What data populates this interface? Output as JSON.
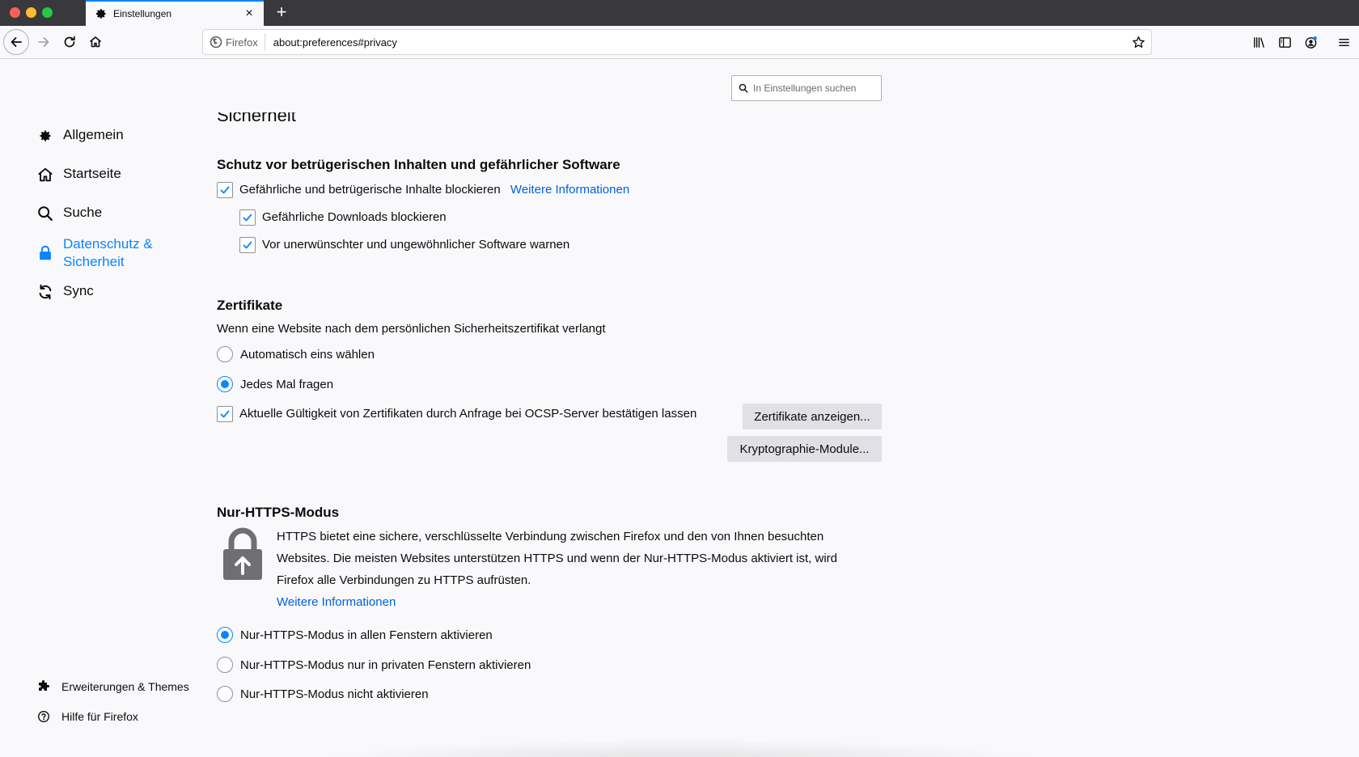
{
  "tab": {
    "title": "Einstellungen",
    "icon": "gear-icon",
    "close": "×",
    "new_tab": "+"
  },
  "toolbar": {
    "identity_label": "Firefox",
    "url": "about:preferences#privacy",
    "icons": [
      "back-arrow-icon",
      "forward-arrow-icon",
      "reload-icon",
      "home-icon",
      "bookmark-star-icon",
      "library-icon",
      "sidebar-icon",
      "account-icon",
      "hamburger-menu-icon"
    ]
  },
  "search": {
    "placeholder": "In Einstellungen suchen"
  },
  "sidebar": {
    "items": [
      {
        "label": "Allgemein",
        "icon": "gear-icon"
      },
      {
        "label": "Startseite",
        "icon": "home-icon"
      },
      {
        "label": "Suche",
        "icon": "search-icon"
      },
      {
        "label": "Datenschutz & Sicherheit",
        "icon": "lock-icon",
        "selected": true
      },
      {
        "label": "Sync",
        "icon": "sync-icon"
      }
    ],
    "footer": {
      "extensions_label": "Erweiterungen & Themes",
      "help_label": "Hilfe für Firefox"
    }
  },
  "main": {
    "partial_heading": "Sicherheit",
    "protection": {
      "heading": "Schutz vor betrügerischen Inhalten und gefährlicher Software",
      "block_dangerous": {
        "label": "Gefährliche und betrügerische Inhalte blockieren",
        "checked": true
      },
      "learn_more": "Weitere Informationen",
      "block_downloads": {
        "label": "Gefährliche Downloads blockieren",
        "checked": true
      },
      "warn_unwanted": {
        "label": "Vor unerwünschter und ungewöhnlicher Software warnen",
        "checked": true
      }
    },
    "certificates": {
      "heading": "Zertifikate",
      "intro": "Wenn eine Website nach dem persönlichen Sicherheitszertifikat verlangt",
      "auto_select": {
        "label": "Automatisch eins wählen",
        "selected": false
      },
      "ask_every_time": {
        "label": "Jedes Mal fragen",
        "selected": true
      },
      "ocsp": {
        "label": "Aktuelle Gültigkeit von Zertifikaten durch Anfrage bei OCSP-Server bestätigen lassen",
        "checked": true
      },
      "view_button": "Zertifikate anzeigen...",
      "crypto_button": "Kryptographie-Module..."
    },
    "https_only": {
      "heading": "Nur-HTTPS-Modus",
      "description": "HTTPS bietet eine sichere, verschlüsselte Verbindung zwischen Firefox und den von Ihnen besuchten Websites. Die meisten Websites unterstützen HTTPS und wenn der Nur-HTTPS-Modus aktiviert ist, wird Firefox alle Verbindungen zu HTTPS aufrüsten.",
      "learn_more": "Weitere Informationen",
      "all_windows": {
        "label": "Nur-HTTPS-Modus in allen Fenstern aktivieren",
        "selected": true
      },
      "private_only": {
        "label": "Nur-HTTPS-Modus nur in privaten Fenstern aktivieren",
        "selected": false
      },
      "disabled": {
        "label": "Nur-HTTPS-Modus nicht aktivieren",
        "selected": false
      }
    }
  },
  "colors": {
    "accent": "#0a84ff",
    "link": "#0060df",
    "titlebar": "#38383d"
  }
}
